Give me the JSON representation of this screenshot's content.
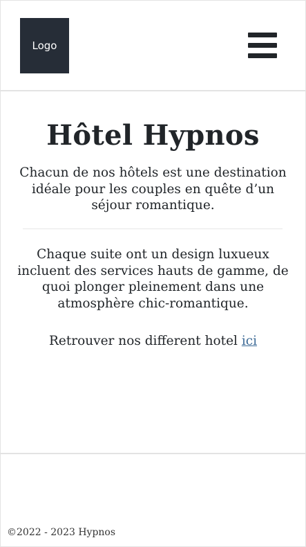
{
  "header": {
    "logo_text": "Logo",
    "menu_icon": "hamburger-menu-icon"
  },
  "main": {
    "title": "Hôtel Hypnos",
    "intro": "Chacun de nos hôtels est une destination idéale pour les couples en quête d’un séjour romantique.",
    "description": "Chaque suite ont un design luxueux incluent des services hauts de gamme, de quoi plonger pleinement dans une atmosphère chic-romantique.",
    "cta_text": "Retrouver nos different hotel ",
    "cta_link": "ici"
  },
  "footer": {
    "copyright": "©2022 - 2023 Hypnos"
  },
  "colors": {
    "logo_bg": "#262d37",
    "text": "#212529",
    "link": "#3c6a96",
    "divider": "#e3e3e3"
  }
}
